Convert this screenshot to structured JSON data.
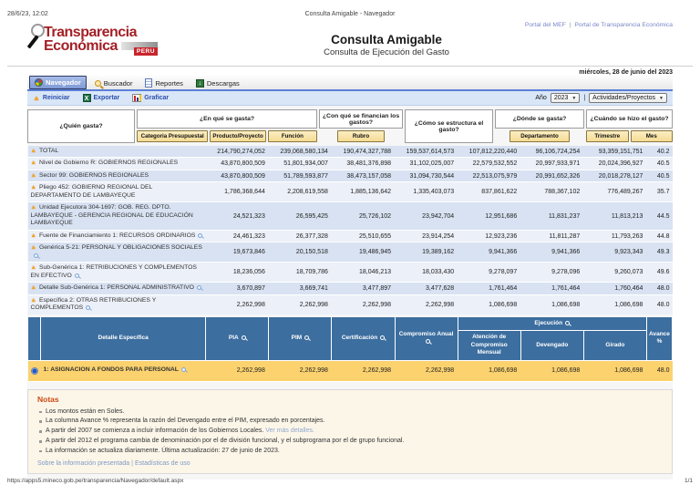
{
  "print": {
    "header_left": "28/6/23, 12:02",
    "header_center": "Consulta Amigable - Navegador",
    "footer_url": "https://apps5.mineco.gob.pe/transparencia/Navegador/default.aspx",
    "footer_page": "1/1"
  },
  "masthead": {
    "logo": {
      "line1": "Transparencia",
      "line2": "Económica",
      "badge": "PERU"
    },
    "portal_links": [
      "Portal del MEF",
      "Portal de Transparencia Económica"
    ],
    "links_divider": "|",
    "title": "Consulta Amigable",
    "subtitle": "Consulta de Ejecución del Gasto",
    "date": "miércoles, 28 de junio del 2023"
  },
  "tabs": [
    {
      "label": "Navegador",
      "icon": "navigator",
      "active": true
    },
    {
      "label": "Buscador",
      "icon": "search",
      "active": false
    },
    {
      "label": "Reportes",
      "icon": "report",
      "active": false
    },
    {
      "label": "Descargas",
      "icon": "download",
      "active": false
    }
  ],
  "actions": [
    {
      "label": "Reiniciar",
      "icon": "reset-triangle"
    },
    {
      "label": "Exportar",
      "icon": "excel"
    },
    {
      "label": "Graficar",
      "icon": "chart"
    }
  ],
  "filters": {
    "year_label": "Año",
    "year_value": "2023",
    "divider": "|",
    "scope_value": "Actividades/Proyectos"
  },
  "query_groups": [
    {
      "question": "¿Quién gasta?",
      "buttons": []
    },
    {
      "question": "¿En qué se gasta?",
      "buttons": [
        "Categoria Presupuestal",
        "Producto/Proyecto",
        "Función"
      ]
    },
    {
      "question": "¿Con qué se financian los gastos?",
      "buttons": [
        "Rubro"
      ]
    },
    {
      "question": "¿Cómo se estructura el gasto?",
      "buttons": []
    },
    {
      "question": "¿Dónde se gasta?",
      "buttons": [
        "Departamento"
      ]
    },
    {
      "question": "¿Cuándo se hizo el gasto?",
      "buttons": [
        "Trimestre",
        "Mes"
      ]
    }
  ],
  "grid": {
    "rows": [
      {
        "label": "TOTAL",
        "mag": false,
        "values": [
          "214,790,274,052",
          "239,068,580,134",
          "190,474,327,788",
          "159,537,614,573",
          "107,812,220,440",
          "96,106,724,254",
          "93,359,151,751"
        ],
        "avance": "40.2"
      },
      {
        "label": "Nivel de Gobierno R: GOBIERNOS REGIONALES",
        "mag": false,
        "values": [
          "43,870,800,509",
          "51,801,934,007",
          "38,481,376,898",
          "31,102,025,007",
          "22,579,532,552",
          "20,997,933,971",
          "20,024,396,927"
        ],
        "avance": "40.5"
      },
      {
        "label": "Sector 99: GOBIERNOS REGIONALES",
        "mag": false,
        "values": [
          "43,870,800,509",
          "51,789,593,877",
          "38,473,157,058",
          "31,094,730,544",
          "22,513,075,979",
          "20,991,652,326",
          "20,018,278,127"
        ],
        "avance": "40.5"
      },
      {
        "label": "Pliego 452: GOBIERNO REGIONAL DEL DEPARTAMENTO DE LAMBAYEQUE",
        "mag": false,
        "values": [
          "1,786,368,644",
          "2,208,619,558",
          "1,885,136,642",
          "1,335,403,073",
          "837,861,622",
          "788,367,102",
          "776,489,267"
        ],
        "avance": "35.7"
      },
      {
        "label": "Unidad Ejecutora 304-1697: GOB. REG. DPTO. LAMBAYEQUE - GERENCIA REGIONAL DE EDUCACIÓN LAMBAYEQUE",
        "mag": false,
        "values": [
          "24,521,323",
          "26,595,425",
          "25,726,102",
          "23,942,704",
          "12,951,686",
          "11,831,237",
          "11,813,213"
        ],
        "avance": "44.5"
      },
      {
        "label": "Fuente de Financiamiento 1: RECURSOS ORDINARIOS",
        "mag": true,
        "values": [
          "24,461,323",
          "26,377,328",
          "25,510,655",
          "23,914,254",
          "12,923,236",
          "11,811,287",
          "11,793,263"
        ],
        "avance": "44.8"
      },
      {
        "label": "Genérica 5-21: PERSONAL Y OBLIGACIONES SOCIALES",
        "mag": true,
        "values": [
          "19,673,846",
          "20,150,518",
          "19,486,945",
          "19,389,162",
          "9,941,366",
          "9,941,366",
          "9,923,343"
        ],
        "avance": "49.3"
      },
      {
        "label": "Sub-Genérica 1: RETRIBUCIONES Y COMPLEMENTOS EN EFECTIVO",
        "mag": true,
        "values": [
          "18,236,056",
          "18,709,786",
          "18,046,213",
          "18,033,430",
          "9,278,097",
          "9,278,096",
          "9,260,073"
        ],
        "avance": "49.6"
      },
      {
        "label": "Detalle Sub-Genérica 1: PERSONAL ADMINISTRATIVO",
        "mag": true,
        "values": [
          "3,670,897",
          "3,669,741",
          "3,477,897",
          "3,477,628",
          "1,761,464",
          "1,761,464",
          "1,760,464"
        ],
        "avance": "48.0"
      },
      {
        "label": "Específica 2: OTRAS RETRIBUCIONES Y COMPLEMENTOS",
        "mag": true,
        "values": [
          "2,262,998",
          "2,262,998",
          "2,262,998",
          "2,262,998",
          "1,086,698",
          "1,086,698",
          "1,086,698"
        ],
        "avance": "48.0"
      }
    ]
  },
  "detail": {
    "header": {
      "label": "Detalle Específica",
      "pia": "PIA",
      "pim": "PIM",
      "cert": "Certificación",
      "comp": "Compromiso Anual",
      "ejecucion": "Ejecución",
      "sub": [
        "Atención de Compromiso Mensual",
        "Devengado",
        "Girado"
      ],
      "avance": "Avance %"
    },
    "rows": [
      {
        "selected": true,
        "label": "1: ASIGNACION A FONDOS PARA PERSONAL",
        "mag": true,
        "values": [
          "2,262,998",
          "2,262,998",
          "2,262,998",
          "2,262,998",
          "1,086,698",
          "1,086,698",
          "1,086,698"
        ],
        "avance": "48.0"
      }
    ]
  },
  "notes": {
    "title": "Notas",
    "items": [
      {
        "text": "Los montos están en Soles."
      },
      {
        "text": "La columna Avance % representa la razón del Devengado entre el PIM, expresado en porcentajes."
      },
      {
        "text": "A partir del 2007 se comienza a incluir información de los Gobiernos Locales.",
        "link": "Ver más detalles."
      },
      {
        "text": "A partir del 2012 el programa cambia de denominación por el de división funcional, y el subprograma por el de grupo funcional."
      },
      {
        "text": "La información se actualiza diariamente. Última actualización: 27 de junio de 2023."
      }
    ],
    "links": [
      "Sobre la información presentada",
      "Estadísticas de uso"
    ],
    "links_divider": "|"
  }
}
